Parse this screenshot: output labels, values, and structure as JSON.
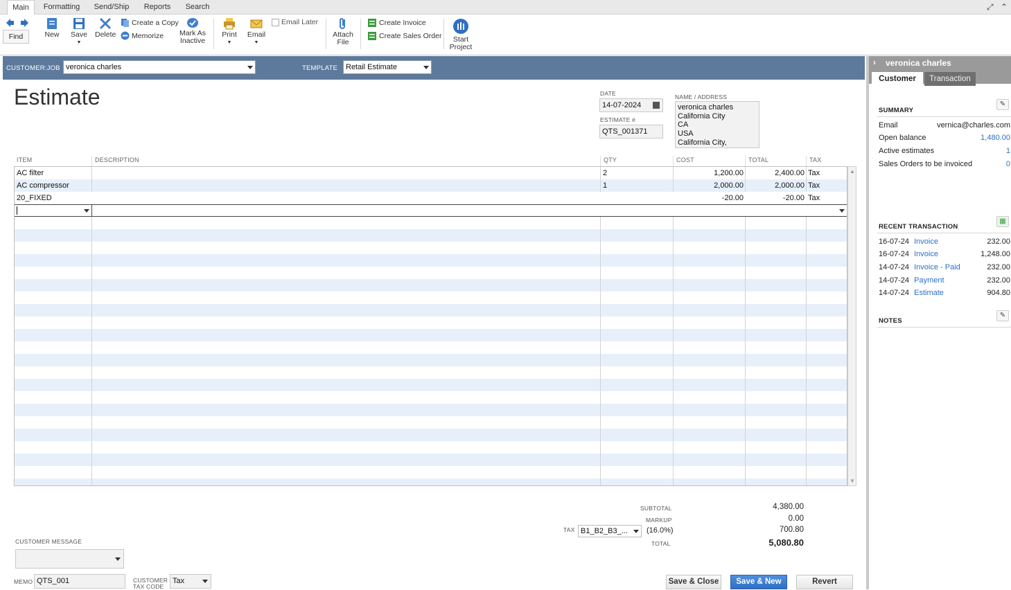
{
  "menu": {
    "tabs": [
      "Main",
      "Formatting",
      "Send/Ship",
      "Reports",
      "Search"
    ]
  },
  "toolbar": {
    "find": "Find",
    "new": "New",
    "save": "Save",
    "delete": "Delete",
    "create_copy": "Create a Copy",
    "memorize": "Memorize",
    "mark_as_inactive_1": "Mark As",
    "mark_as_inactive_2": "Inactive",
    "print": "Print",
    "email": "Email",
    "email_later": "Email Later",
    "attach_file_1": "Attach",
    "attach_file_2": "File",
    "create_invoice": "Create Invoice",
    "create_sales_order": "Create Sales Order",
    "start_project_1": "Start",
    "start_project_2": "Project"
  },
  "header": {
    "customer_job_label": "CUSTOMER:JOB",
    "customer_job_value": "veronica charles",
    "template_label": "TEMPLATE",
    "template_value": "Retail Estimate"
  },
  "form": {
    "title": "Estimate",
    "date_label": "DATE",
    "date_value": "14-07-2024",
    "estimate_no_label": "ESTIMATE #",
    "estimate_no_value": "QTS_001371",
    "name_address_label": "NAME / ADDRESS",
    "address_lines": [
      "veronica charles",
      "California City",
      "CA",
      "USA",
      "California City, California"
    ]
  },
  "grid": {
    "columns": [
      "ITEM",
      "DESCRIPTION",
      "QTY",
      "COST",
      "TOTAL",
      "TAX"
    ],
    "rows": [
      {
        "item": "AC filter",
        "description": "",
        "qty": "2",
        "cost": "1,200.00",
        "total": "2,400.00",
        "tax": "Tax"
      },
      {
        "item": "AC compressor",
        "description": "",
        "qty": "1",
        "cost": "2,000.00",
        "total": "2,000.00",
        "tax": "Tax"
      },
      {
        "item": "20_FIXED",
        "description": "",
        "qty": "",
        "cost": "-20.00",
        "total": "-20.00",
        "tax": "Tax"
      }
    ]
  },
  "totals": {
    "subtotal_label": "SUBTOTAL",
    "subtotal_value": "4,380.00",
    "markup_label": "MARKUP",
    "markup_value": "0.00",
    "tax_label": "TAX",
    "tax_code": "B1_B2_B3_...",
    "tax_rate": "(16.0%)",
    "tax_value": "700.80",
    "total_label": "TOTAL",
    "total_value": "5,080.80"
  },
  "footer": {
    "customer_message_label": "CUSTOMER MESSAGE",
    "memo_label": "MEMO",
    "memo_value": "QTS_001",
    "customer_tax_code_label_1": "CUSTOMER",
    "customer_tax_code_label_2": "TAX CODE",
    "customer_tax_code_value": "Tax",
    "save_close": "Save & Close",
    "save_new": "Save & New",
    "revert": "Revert"
  },
  "panel": {
    "title": "veronica charles",
    "tab_customer": "Customer",
    "tab_transaction": "Transaction",
    "summary_label": "SUMMARY",
    "summary": [
      {
        "label": "Email",
        "value": "vernica@charles.com",
        "link": false
      },
      {
        "label": "Open balance",
        "value": "1,480.00",
        "link": true
      },
      {
        "label": "Active estimates",
        "value": "1",
        "link": true
      },
      {
        "label": "Sales Orders to be invoiced",
        "value": "0",
        "link": true
      }
    ],
    "recent_label": "RECENT TRANSACTION",
    "recent": [
      {
        "date": "16-07-24",
        "type": "Invoice",
        "amount": "232.00"
      },
      {
        "date": "16-07-24",
        "type": "Invoice",
        "amount": "1,248.00"
      },
      {
        "date": "14-07-24",
        "type": "Invoice - Paid",
        "amount": "232.00"
      },
      {
        "date": "14-07-24",
        "type": "Payment",
        "amount": "232.00"
      },
      {
        "date": "14-07-24",
        "type": "Estimate",
        "amount": "904.80"
      }
    ],
    "notes_label": "NOTES"
  },
  "colors": {
    "header_band": "#5d7a9c",
    "link": "#2a6fc9",
    "row_stripe": "#e7f0fa",
    "primary_button": "#2f6fc4"
  }
}
